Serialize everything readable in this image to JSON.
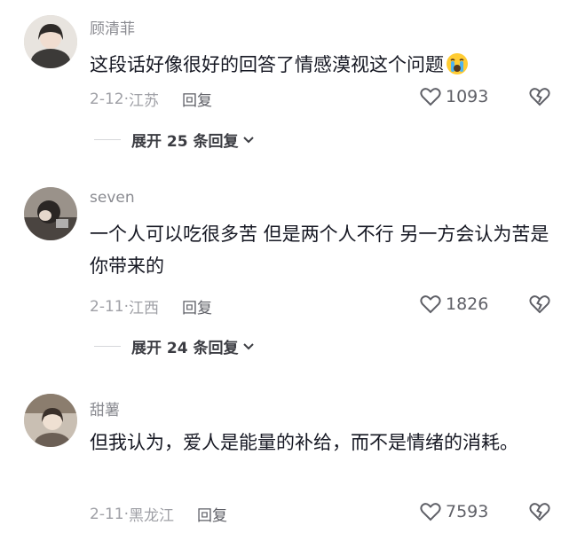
{
  "comments": [
    {
      "username": "顾清菲",
      "text": "这段话好像很好的回答了情感漠视这个问题",
      "date": "2-12·",
      "location": "江苏",
      "reply_label": "回复",
      "likes": "1093",
      "expand_label": "展开 25 条回复"
    },
    {
      "username": "seven",
      "text": "一个人可以吃很多苦 但是两个人不行 另一方会认为苦是你带来的",
      "date": "2-11·",
      "location": "江西",
      "reply_label": "回复",
      "likes": "1826",
      "expand_label": "展开 24 条回复"
    },
    {
      "username": "甜薯",
      "text": "但我认为，爱人是能量的补给，而不是情绪的消耗。",
      "date": "2-11·",
      "location": "黑龙江",
      "reply_label": "回复",
      "likes": "7593"
    }
  ],
  "icons": {
    "like": "heart-outline-icon",
    "dislike": "broken-heart-icon",
    "expand": "chevron-down-icon",
    "emoji": "crying-face-emoji"
  },
  "colors": {
    "username": "#8a8b91",
    "text": "#161823",
    "meta": "#9fa0a6"
  }
}
